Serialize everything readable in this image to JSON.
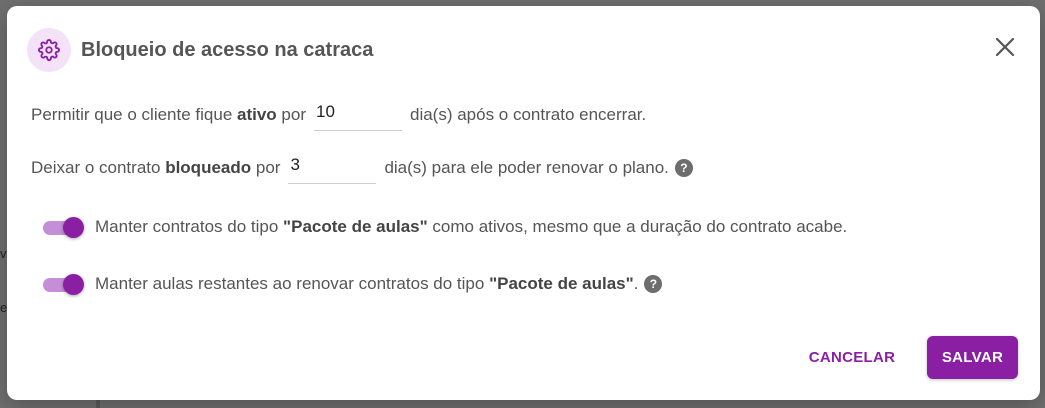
{
  "dialog": {
    "title": "Bloqueio de acesso na catraca",
    "header_icon": "gear-icon",
    "close_icon": "close-icon"
  },
  "active_row": {
    "prefix": "Permitir que o cliente fique ",
    "bold": "ativo",
    "mid": " por",
    "value": "10",
    "suffix": "dia(s) após o contrato encerrar."
  },
  "blocked_row": {
    "prefix": "Deixar o contrato ",
    "bold": "bloqueado",
    "mid": " por",
    "value": "3",
    "suffix": "dia(s) para ele poder renovar o plano.",
    "help": "?"
  },
  "toggle1": {
    "on": true,
    "prefix": "Manter contratos do tipo ",
    "bold": "\"Pacote de aulas\"",
    "suffix": " como ativos, mesmo que a duração do contrato acabe."
  },
  "toggle2": {
    "on": true,
    "prefix": "Manter aulas restantes ao renovar contratos do tipo ",
    "bold": "\"Pacote de aulas\"",
    "suffix": ".",
    "help": "?"
  },
  "actions": {
    "cancel": "CANCELAR",
    "save": "SALVAR"
  },
  "colors": {
    "accent": "#8a1fa3",
    "accent_light": "#c58fd8",
    "icon_bg": "#f3e2f8"
  },
  "backdrop": {
    "fragment1": "v",
    "fragment2": "e"
  }
}
